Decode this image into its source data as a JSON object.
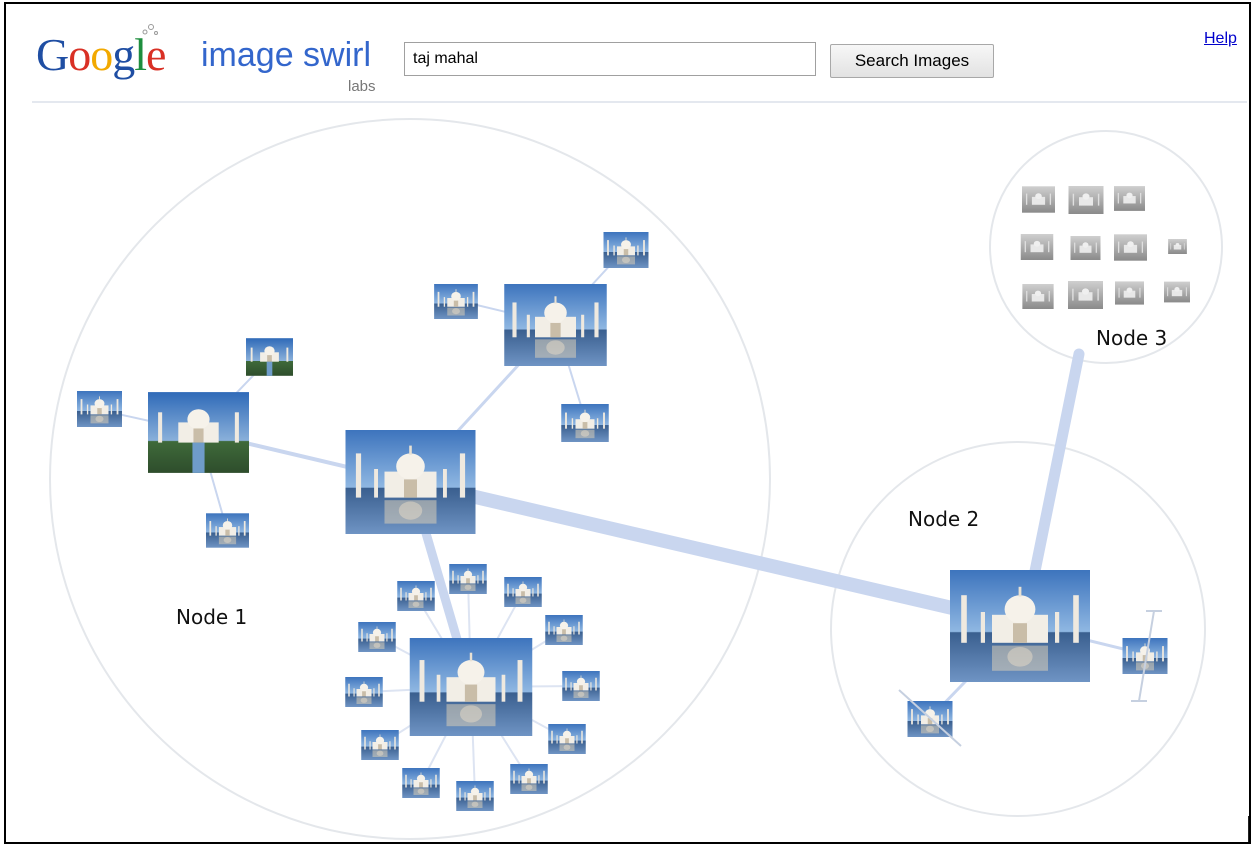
{
  "header": {
    "logo_letters": [
      "G",
      "o",
      "o",
      "g",
      "l",
      "e"
    ],
    "logo_colors": [
      "#1f4ea3",
      "#d93025",
      "#f2a900",
      "#1f4ea3",
      "#1e8e3e",
      "#d93025"
    ],
    "product_name": "image swirl",
    "labs_label": "labs",
    "search_value": "taj mahal",
    "search_button_label": "Search Images",
    "help_link": "Help"
  },
  "nodes": {
    "node1_label": "Node 1",
    "node2_label": "Node 2",
    "node3_label": "Node 3"
  },
  "colors": {
    "edge": "#c9d6ef",
    "circle": "#e3e6ea",
    "sky": "#4f86c6",
    "marble": "#f0ece4"
  },
  "icons": {
    "logo_flask": "flask-icon"
  }
}
